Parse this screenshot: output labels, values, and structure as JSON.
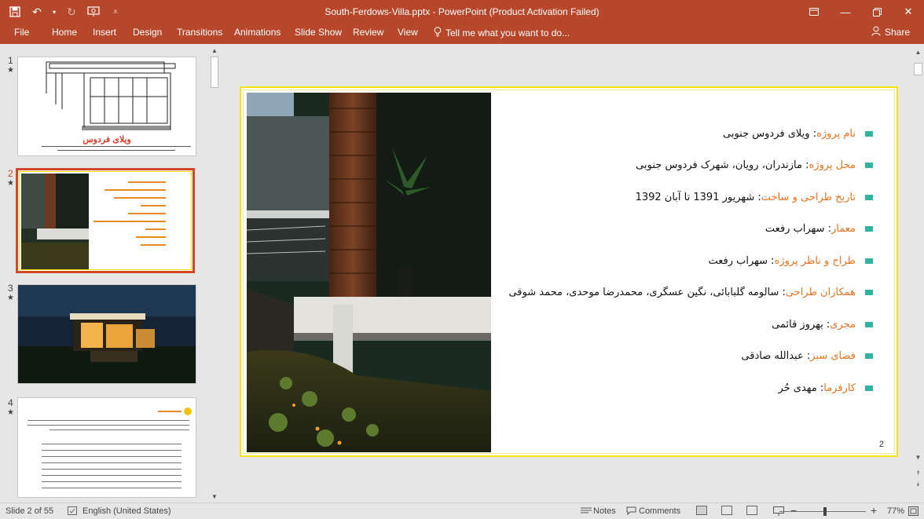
{
  "window": {
    "title": "South-Ferdows-Villa.pptx - PowerPoint (Product Activation Failed)",
    "quick_access": [
      "save-icon",
      "undo-icon",
      "redo-icon",
      "presentation-icon",
      "customize-icon"
    ]
  },
  "ribbon": {
    "tabs": [
      "File",
      "Home",
      "Insert",
      "Design",
      "Transitions",
      "Animations",
      "Slide Show",
      "Review",
      "View"
    ],
    "tell_me": "Tell me what you want to do...",
    "share": "Share"
  },
  "thumbnails": [
    {
      "number": "1",
      "star": "★",
      "title": "ویلای فردوس"
    },
    {
      "number": "2",
      "star": "★"
    },
    {
      "number": "3",
      "star": "★"
    },
    {
      "number": "4",
      "star": "★"
    }
  ],
  "slide": {
    "page_number": "2",
    "bullets": [
      {
        "label": "نام پروژه",
        "value": ": ویلای فردوس جنوبی"
      },
      {
        "label": "محل پروژه",
        "value": ": مازندران، رویان، شهرک فردوس جنوبی"
      },
      {
        "label": "تاریخ طراحی و ساخت",
        "value": ": شهریور 1391 تا آبان 1392"
      },
      {
        "label": "معمار",
        "value": ": سهراب رفعت"
      },
      {
        "label": "طراح و ناظر پروژه",
        "value": ": سهراب رفعت"
      },
      {
        "label": "همکاران طراحی",
        "value": ": سالومه گلبابائی، نگین عسگری، محمدرضا موحدی، محمد شوقی"
      },
      {
        "label": "مجری",
        "value": ": بهروز قائمی"
      },
      {
        "label": "فضای سبز",
        "value": ": عبدالله صادقی"
      },
      {
        "label": "کارفرما",
        "value": ": مهدی حُر"
      }
    ]
  },
  "statusbar": {
    "slide_info": "Slide 2 of 55",
    "language": "English (United States)",
    "notes": "Notes",
    "comments": "Comments",
    "zoom_minus": "−",
    "zoom_plus": "+",
    "zoom": "77%"
  },
  "colors": {
    "accent": "#b7472a",
    "bullet_label": "#e8731f",
    "bullet_mark": "#2fb59f",
    "slide_border": "#f4e20c"
  }
}
